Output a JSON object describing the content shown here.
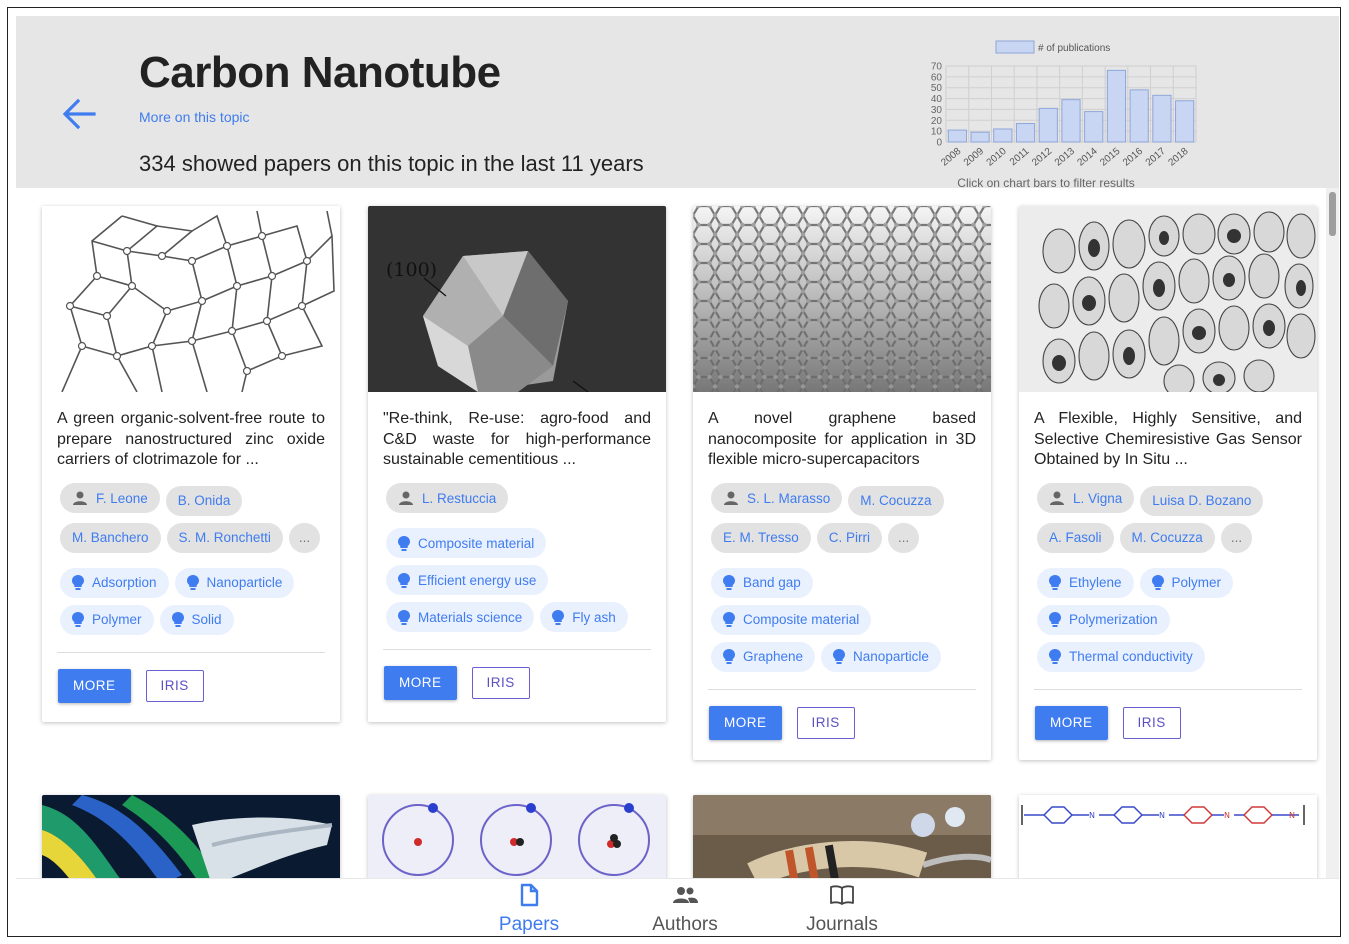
{
  "header": {
    "title": "Carbon Nanotube",
    "more_link": "More on this topic",
    "summary": "334 showed papers on this topic in the last 11 years"
  },
  "chart_data": {
    "type": "bar",
    "legend": "# of publications",
    "categories": [
      "2008",
      "2009",
      "2010",
      "2011",
      "2012",
      "2013",
      "2014",
      "2015",
      "2016",
      "2017",
      "2018"
    ],
    "values": [
      11,
      9,
      12,
      17,
      31,
      39,
      28,
      66,
      48,
      43,
      38
    ],
    "ylim": [
      0,
      70
    ],
    "yticks": [
      "70",
      "60",
      "50",
      "40",
      "30",
      "20",
      "10",
      "0"
    ],
    "caption": "Click on chart bars to filter results",
    "bar_color": "#c9d6f3"
  },
  "cards": [
    {
      "title": "A green organic-solvent-free route to prepare nanostructured zinc oxide carriers of clotrimazole for ...",
      "authors": [
        "F. Leone",
        "B. Onida",
        "M. Banchero",
        "S. M. Ronchetti"
      ],
      "ellipsis": "...",
      "keywords": [
        "Adsorption",
        "Nanoparticle",
        "Polymer",
        "Solid"
      ],
      "more": "MORE",
      "iris": "IRIS"
    },
    {
      "title": "\"Re-think, Re-use: agro-food and C&D waste for high-performance sustainable cementitious ...",
      "authors": [
        "L. Restuccia"
      ],
      "keywords": [
        "Composite material",
        "Efficient energy use",
        "Materials science",
        "Fly ash"
      ],
      "image_label": "(100)",
      "more": "MORE",
      "iris": "IRIS"
    },
    {
      "title": "A novel graphene based nanocomposite for application in 3D flexible micro-supercapacitors",
      "authors": [
        "S. L. Marasso",
        "M. Cocuzza",
        "E. M. Tresso",
        "C. Pirri"
      ],
      "ellipsis": "...",
      "keywords": [
        "Band gap",
        "Composite material",
        "Graphene",
        "Nanoparticle"
      ],
      "more": "MORE",
      "iris": "IRIS"
    },
    {
      "title": "A Flexible, Highly Sensitive, and Selective Chemiresistive Gas Sensor Obtained by In Situ ...",
      "authors": [
        "L. Vigna",
        "Luisa D. Bozano",
        "A. Fasoli",
        "M. Cocuzza"
      ],
      "ellipsis": "...",
      "keywords": [
        "Ethylene",
        "Polymer",
        "Polymerization",
        "Thermal conductivity"
      ],
      "more": "MORE",
      "iris": "IRIS"
    }
  ],
  "nav": {
    "papers": "Papers",
    "authors": "Authors",
    "journals": "Journals"
  },
  "colors": {
    "accent": "#3f7cf0",
    "header_bg": "#e6e6e6",
    "iris_border": "#6a5fd0"
  }
}
